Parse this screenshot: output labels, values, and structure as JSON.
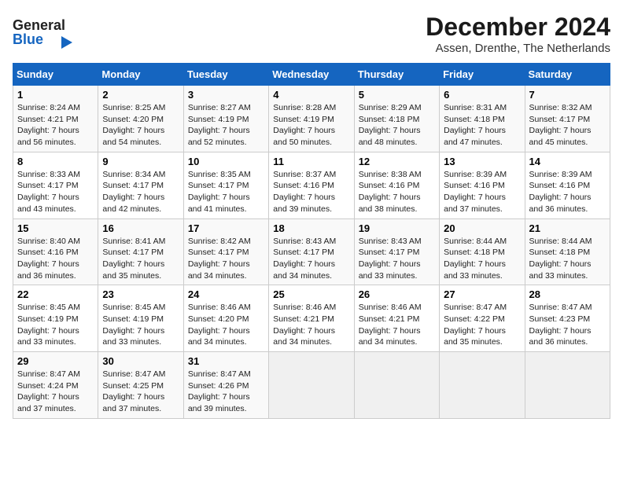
{
  "header": {
    "logo_general": "General",
    "logo_blue": "Blue",
    "month_title": "December 2024",
    "location": "Assen, Drenthe, The Netherlands"
  },
  "days_of_week": [
    "Sunday",
    "Monday",
    "Tuesday",
    "Wednesday",
    "Thursday",
    "Friday",
    "Saturday"
  ],
  "weeks": [
    [
      {
        "day": "1",
        "sunrise": "Sunrise: 8:24 AM",
        "sunset": "Sunset: 4:21 PM",
        "daylight": "Daylight: 7 hours and 56 minutes."
      },
      {
        "day": "2",
        "sunrise": "Sunrise: 8:25 AM",
        "sunset": "Sunset: 4:20 PM",
        "daylight": "Daylight: 7 hours and 54 minutes."
      },
      {
        "day": "3",
        "sunrise": "Sunrise: 8:27 AM",
        "sunset": "Sunset: 4:19 PM",
        "daylight": "Daylight: 7 hours and 52 minutes."
      },
      {
        "day": "4",
        "sunrise": "Sunrise: 8:28 AM",
        "sunset": "Sunset: 4:19 PM",
        "daylight": "Daylight: 7 hours and 50 minutes."
      },
      {
        "day": "5",
        "sunrise": "Sunrise: 8:29 AM",
        "sunset": "Sunset: 4:18 PM",
        "daylight": "Daylight: 7 hours and 48 minutes."
      },
      {
        "day": "6",
        "sunrise": "Sunrise: 8:31 AM",
        "sunset": "Sunset: 4:18 PM",
        "daylight": "Daylight: 7 hours and 47 minutes."
      },
      {
        "day": "7",
        "sunrise": "Sunrise: 8:32 AM",
        "sunset": "Sunset: 4:17 PM",
        "daylight": "Daylight: 7 hours and 45 minutes."
      }
    ],
    [
      {
        "day": "8",
        "sunrise": "Sunrise: 8:33 AM",
        "sunset": "Sunset: 4:17 PM",
        "daylight": "Daylight: 7 hours and 43 minutes."
      },
      {
        "day": "9",
        "sunrise": "Sunrise: 8:34 AM",
        "sunset": "Sunset: 4:17 PM",
        "daylight": "Daylight: 7 hours and 42 minutes."
      },
      {
        "day": "10",
        "sunrise": "Sunrise: 8:35 AM",
        "sunset": "Sunset: 4:17 PM",
        "daylight": "Daylight: 7 hours and 41 minutes."
      },
      {
        "day": "11",
        "sunrise": "Sunrise: 8:37 AM",
        "sunset": "Sunset: 4:16 PM",
        "daylight": "Daylight: 7 hours and 39 minutes."
      },
      {
        "day": "12",
        "sunrise": "Sunrise: 8:38 AM",
        "sunset": "Sunset: 4:16 PM",
        "daylight": "Daylight: 7 hours and 38 minutes."
      },
      {
        "day": "13",
        "sunrise": "Sunrise: 8:39 AM",
        "sunset": "Sunset: 4:16 PM",
        "daylight": "Daylight: 7 hours and 37 minutes."
      },
      {
        "day": "14",
        "sunrise": "Sunrise: 8:39 AM",
        "sunset": "Sunset: 4:16 PM",
        "daylight": "Daylight: 7 hours and 36 minutes."
      }
    ],
    [
      {
        "day": "15",
        "sunrise": "Sunrise: 8:40 AM",
        "sunset": "Sunset: 4:16 PM",
        "daylight": "Daylight: 7 hours and 36 minutes."
      },
      {
        "day": "16",
        "sunrise": "Sunrise: 8:41 AM",
        "sunset": "Sunset: 4:17 PM",
        "daylight": "Daylight: 7 hours and 35 minutes."
      },
      {
        "day": "17",
        "sunrise": "Sunrise: 8:42 AM",
        "sunset": "Sunset: 4:17 PM",
        "daylight": "Daylight: 7 hours and 34 minutes."
      },
      {
        "day": "18",
        "sunrise": "Sunrise: 8:43 AM",
        "sunset": "Sunset: 4:17 PM",
        "daylight": "Daylight: 7 hours and 34 minutes."
      },
      {
        "day": "19",
        "sunrise": "Sunrise: 8:43 AM",
        "sunset": "Sunset: 4:17 PM",
        "daylight": "Daylight: 7 hours and 33 minutes."
      },
      {
        "day": "20",
        "sunrise": "Sunrise: 8:44 AM",
        "sunset": "Sunset: 4:18 PM",
        "daylight": "Daylight: 7 hours and 33 minutes."
      },
      {
        "day": "21",
        "sunrise": "Sunrise: 8:44 AM",
        "sunset": "Sunset: 4:18 PM",
        "daylight": "Daylight: 7 hours and 33 minutes."
      }
    ],
    [
      {
        "day": "22",
        "sunrise": "Sunrise: 8:45 AM",
        "sunset": "Sunset: 4:19 PM",
        "daylight": "Daylight: 7 hours and 33 minutes."
      },
      {
        "day": "23",
        "sunrise": "Sunrise: 8:45 AM",
        "sunset": "Sunset: 4:19 PM",
        "daylight": "Daylight: 7 hours and 33 minutes."
      },
      {
        "day": "24",
        "sunrise": "Sunrise: 8:46 AM",
        "sunset": "Sunset: 4:20 PM",
        "daylight": "Daylight: 7 hours and 34 minutes."
      },
      {
        "day": "25",
        "sunrise": "Sunrise: 8:46 AM",
        "sunset": "Sunset: 4:21 PM",
        "daylight": "Daylight: 7 hours and 34 minutes."
      },
      {
        "day": "26",
        "sunrise": "Sunrise: 8:46 AM",
        "sunset": "Sunset: 4:21 PM",
        "daylight": "Daylight: 7 hours and 34 minutes."
      },
      {
        "day": "27",
        "sunrise": "Sunrise: 8:47 AM",
        "sunset": "Sunset: 4:22 PM",
        "daylight": "Daylight: 7 hours and 35 minutes."
      },
      {
        "day": "28",
        "sunrise": "Sunrise: 8:47 AM",
        "sunset": "Sunset: 4:23 PM",
        "daylight": "Daylight: 7 hours and 36 minutes."
      }
    ],
    [
      {
        "day": "29",
        "sunrise": "Sunrise: 8:47 AM",
        "sunset": "Sunset: 4:24 PM",
        "daylight": "Daylight: 7 hours and 37 minutes."
      },
      {
        "day": "30",
        "sunrise": "Sunrise: 8:47 AM",
        "sunset": "Sunset: 4:25 PM",
        "daylight": "Daylight: 7 hours and 37 minutes."
      },
      {
        "day": "31",
        "sunrise": "Sunrise: 8:47 AM",
        "sunset": "Sunset: 4:26 PM",
        "daylight": "Daylight: 7 hours and 39 minutes."
      },
      null,
      null,
      null,
      null
    ]
  ]
}
